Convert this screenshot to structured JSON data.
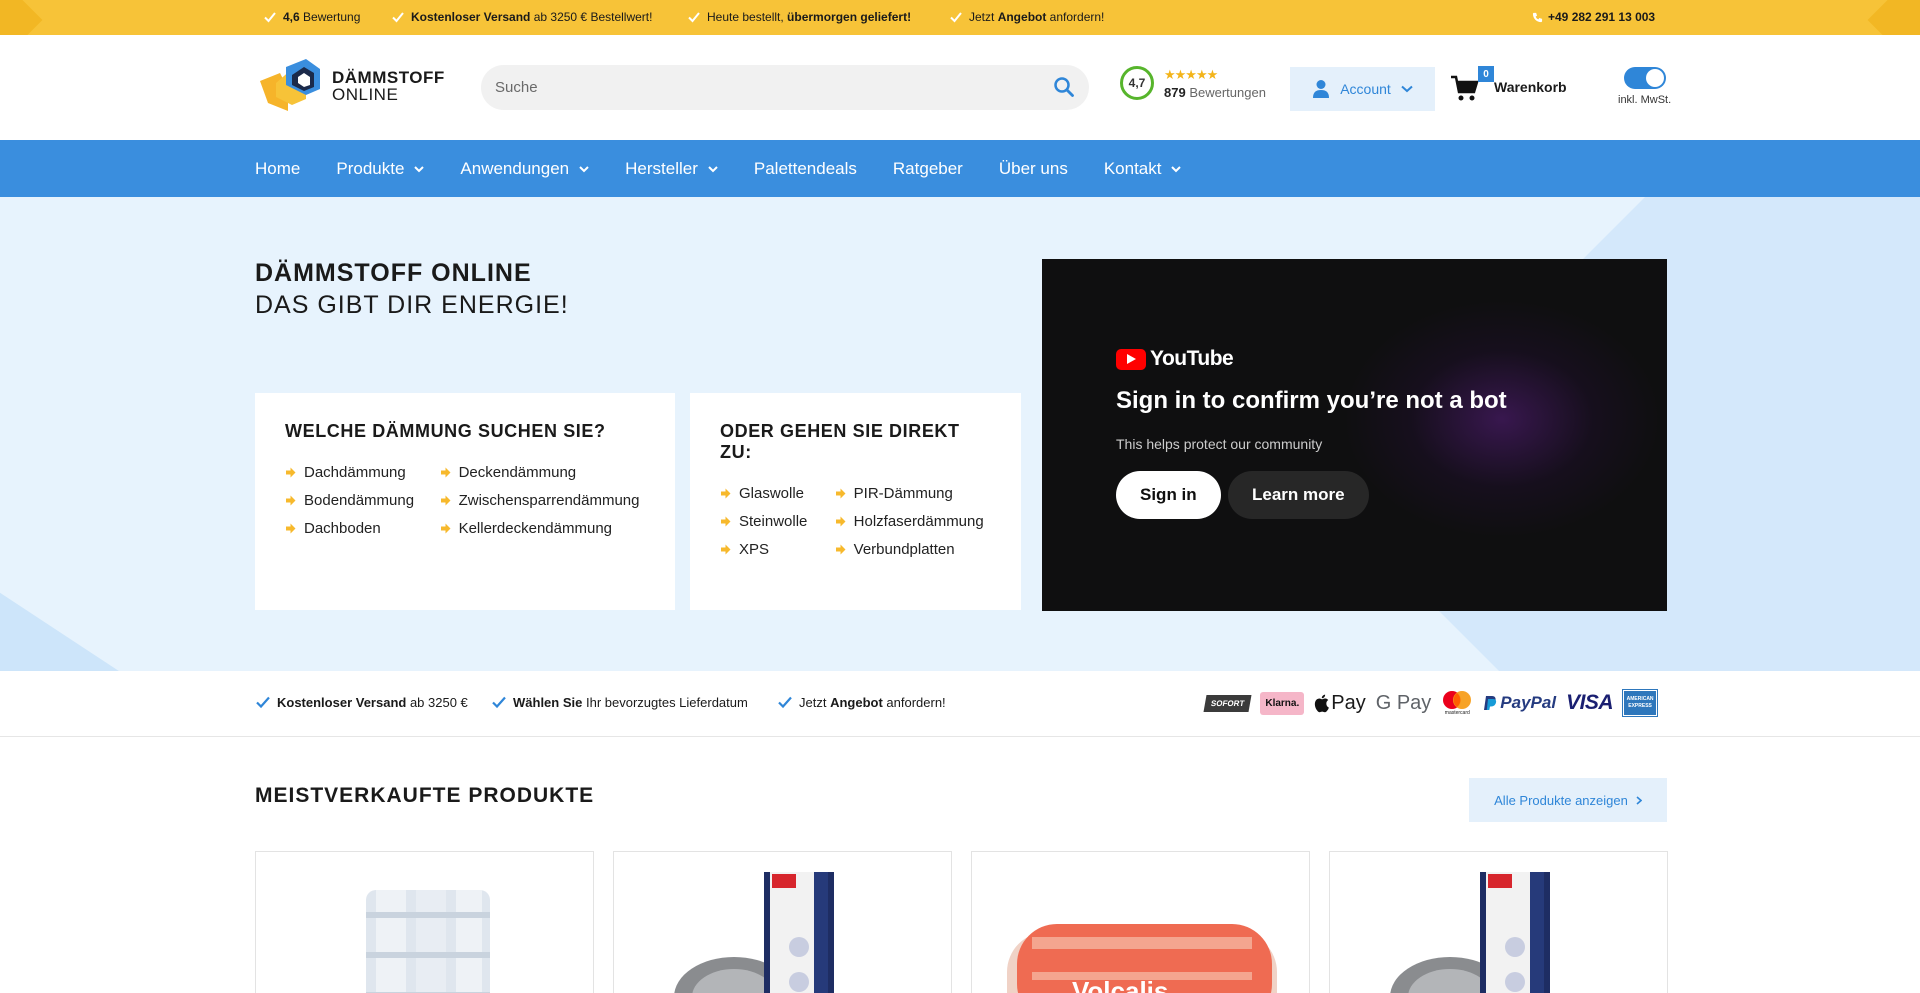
{
  "topbar": {
    "usps": [
      {
        "bold": "4,6",
        "text": " Bewertung"
      },
      {
        "bold": "Kostenloser Versand",
        "text": " ab 3250 € Bestellwert!"
      },
      {
        "pre": "Heute bestellt, ",
        "bold": "übermorgen geliefert!"
      },
      {
        "pre": "Jetzt ",
        "bold": "Angebot",
        "text": " anfordern!"
      }
    ],
    "phone": "+49 282 291 13 003"
  },
  "header": {
    "logo_line1": "DÄMMSTOFF",
    "logo_line2": "ONLINE",
    "search_placeholder": "Suche",
    "rating_score": "4,7",
    "rating_stars": "★★★★★",
    "rating_count": "879",
    "rating_label": "Bewertungen",
    "account_label": "Account",
    "cart_count": "0",
    "cart_label": "Warenkorb",
    "vat_label": "inkl. MwSt."
  },
  "nav": {
    "items": [
      {
        "label": "Home",
        "dropdown": false
      },
      {
        "label": "Produkte",
        "dropdown": true
      },
      {
        "label": "Anwendungen",
        "dropdown": true
      },
      {
        "label": "Hersteller",
        "dropdown": true
      },
      {
        "label": "Palettendeals",
        "dropdown": false
      },
      {
        "label": "Ratgeber",
        "dropdown": false
      },
      {
        "label": "Über uns",
        "dropdown": false
      },
      {
        "label": "Kontakt",
        "dropdown": true
      }
    ]
  },
  "hero": {
    "title": "DÄMMSTOFF ONLINE",
    "subtitle": "DAS GIBT DIR ENERGIE!",
    "card1": {
      "title": "WELCHE DÄMMUNG SUCHEN SIE?",
      "links": [
        "Dachdämmung",
        "Deckendämmung",
        "Bodendämmung",
        "Zwischensparrendämmung",
        "Dachboden",
        "Kellerdeckendämmung"
      ]
    },
    "card2": {
      "title": "ODER GEHEN SIE DIREKT ZU:",
      "links": [
        "Glaswolle",
        "PIR-Dämmung",
        "Steinwolle",
        "Holzfaserdämmung",
        "XPS",
        "Verbundplatten"
      ]
    },
    "video": {
      "brand": "YouTube",
      "title": "Sign in to confirm you’re not a bot",
      "subtitle": "This helps protect our community",
      "signin": "Sign in",
      "learn": "Learn more"
    }
  },
  "strip": {
    "usps": [
      {
        "bold": "Kostenloser Versand",
        "text": " ab 3250 €"
      },
      {
        "bold": "Wählen Sie",
        "text": " Ihr bevorzugtes Lieferdatum"
      },
      {
        "pre": "Jetzt ",
        "bold": "Angebot",
        "text": " anfordern!"
      }
    ],
    "payments": [
      "SOFORT",
      "Klarna.",
      "Pay",
      "G Pay",
      "mastercard",
      "PayPal",
      "VISA",
      "AMERICAN EXPRESS"
    ]
  },
  "bestseller": {
    "title": "MEISTVERKAUFTE PRODUKTE",
    "all_button": "Alle Produkte anzeigen"
  },
  "colors": {
    "topbar": "#f7c338",
    "nav": "#3a8ede",
    "accent": "#2f86d8",
    "hero_bg": "#e7f3fd"
  }
}
